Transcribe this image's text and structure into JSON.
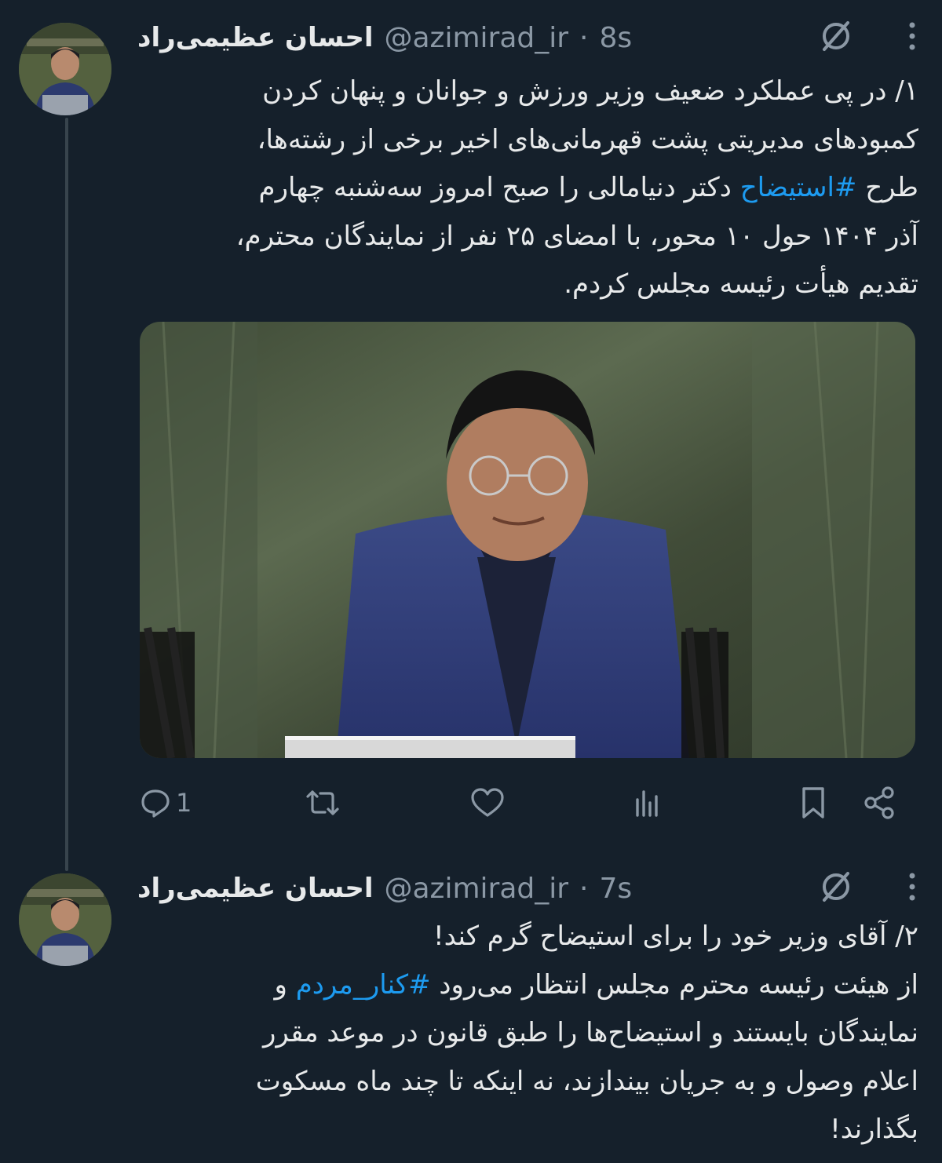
{
  "thread": {
    "tweets": [
      {
        "author": {
          "display_name": "احسان عظیمی‌راد",
          "handle": "@azimirad_ir",
          "separator": "·",
          "time": "8s"
        },
        "text_lines": [
          "۱/ در پی عملکرد ضعیف وزیر ورزش و جوانان و پنهان کردن",
          "کمبودهای مدیریتی پشت قهرمانی‌های اخیر برخی از رشته‌ها،",
          [
            "طرح ",
            "#استیضاح",
            " دکتر دنیامالی را صبح امروز سه‌شنبه چهارم"
          ],
          "آذر ۱۴۰۴ حول ۱۰ محور، با امضای ۲۵ نفر از نمایندگان محترم،",
          "تقدیم هیأت رئیسه مجلس کردم."
        ],
        "line1": "۱/ در پی عملکرد ضعیف وزیر ورزش و جوانان و پنهان کردن",
        "line2": "کمبودهای مدیریتی پشت قهرمانی‌های اخیر برخی از رشته‌ها،",
        "line3_pre": "طرح ",
        "line3_hashtag": "#استیضاح",
        "line3_post": " دکتر دنیامالی را صبح امروز سه‌شنبه چهارم",
        "line4": "آذر ۱۴۰۴ حول ۱۰ محور، با امضای ۲۵ نفر از نمایندگان محترم،",
        "line5": "تقدیم هیأت رئیسه مجلس کردم.",
        "has_media": true,
        "actions": {
          "reply_count": "1",
          "retweet_count": "",
          "like_count": ""
        },
        "icons": [
          "grok-icon",
          "more-icon",
          "reply-icon",
          "retweet-icon",
          "like-icon",
          "views-icon",
          "bookmark-icon",
          "share-icon"
        ]
      },
      {
        "author": {
          "display_name": "احسان عظیمی‌راد",
          "handle": "@azimirad_ir",
          "separator": "·",
          "time": "7s"
        },
        "line1": "۲/ آقای وزیر خود را برای استیضاح گرم کند!",
        "line2_pre": "از هیئت رئیسه محترم مجلس انتظار می‌رود ",
        "line2_hashtag": "#کنار_مردم",
        "line2_post": " و",
        "line3": "نمایندگان بایستند و استیضاح‌ها را طبق قانون در موعد مقرر",
        "line4": "اعلام وصول و به جریان بیندازند، نه اینکه تا چند ماه مسکوت",
        "line5": "بگذارند!"
      }
    ]
  },
  "colors": {
    "background": "#15202b",
    "text": "#e7e9ea",
    "secondary": "#8b98a5",
    "link": "#1d9bf0",
    "thread_line": "#38444d"
  }
}
